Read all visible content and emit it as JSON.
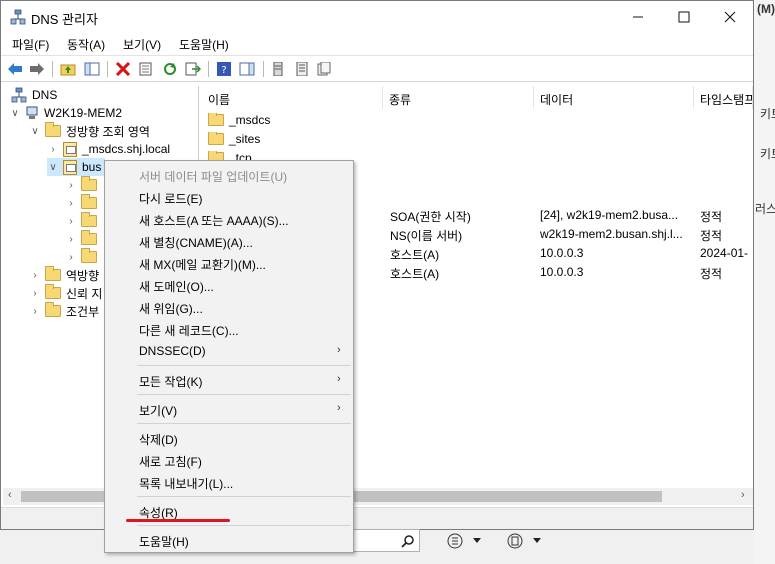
{
  "window": {
    "title": "DNS 관리자",
    "menu": [
      "파일(F)",
      "동작(A)",
      "보기(V)",
      "도움말(H)"
    ]
  },
  "background": {
    "right_edge_texts": [
      "(M)",
      "키트",
      "키트",
      "러스"
    ]
  },
  "tree": {
    "root": "DNS",
    "server": "W2K19-MEM2",
    "forward_zones": "정방향 조회 영역",
    "zone_msdcs": "_msdcs.shj.local",
    "zone_busan": "bus",
    "reverse_zones": "역방향",
    "trust_points": "신뢰 지",
    "conditional": "조건부"
  },
  "list": {
    "columns": [
      "이름",
      "종류",
      "데이터",
      "타임스탬프"
    ],
    "rows": [
      {
        "name": "_msdcs",
        "type": "",
        "data": "",
        "timestamp": ""
      },
      {
        "name": "_sites",
        "type": "",
        "data": "",
        "timestamp": ""
      },
      {
        "name": "_tcp",
        "type": "",
        "data": "",
        "timestamp": ""
      },
      {
        "name": "",
        "type": "SOA(권한 시작)",
        "data": "[24], w2k19-mem2.busa...",
        "timestamp": "정적"
      },
      {
        "name": "",
        "type": "NS(이름 서버)",
        "data": "w2k19-mem2.busan.shj.l...",
        "timestamp": "정적"
      },
      {
        "name": "",
        "type": "호스트(A)",
        "data": "10.0.0.3",
        "timestamp": "2024-01-"
      },
      {
        "name": "",
        "type": "호스트(A)",
        "data": "10.0.0.3",
        "timestamp": "정적"
      }
    ]
  },
  "context_menu": {
    "items": [
      {
        "label": "서버 데이터 파일 업데이트(U)",
        "disabled": true
      },
      {
        "label": "다시 로드(E)"
      },
      {
        "label": "새 호스트(A 또는 AAAA)(S)..."
      },
      {
        "label": "새 별칭(CNAME)(A)..."
      },
      {
        "label": "새 MX(메일 교환기)(M)..."
      },
      {
        "label": "새 도메인(O)..."
      },
      {
        "label": "새 위임(G)..."
      },
      {
        "label": "다른 새 레코드(C)..."
      },
      {
        "label": "DNSSEC(D)",
        "submenu": true
      },
      {
        "label": "모든 작업(K)",
        "submenu": true
      },
      {
        "label": "보기(V)",
        "submenu": true
      },
      {
        "label": "삭제(D)"
      },
      {
        "label": "새로 고침(F)"
      },
      {
        "label": "목록 내보내기(L)..."
      },
      {
        "label": "속성(R)",
        "highlight_color": "#e0141e"
      },
      {
        "label": "도움말(H)"
      }
    ]
  }
}
